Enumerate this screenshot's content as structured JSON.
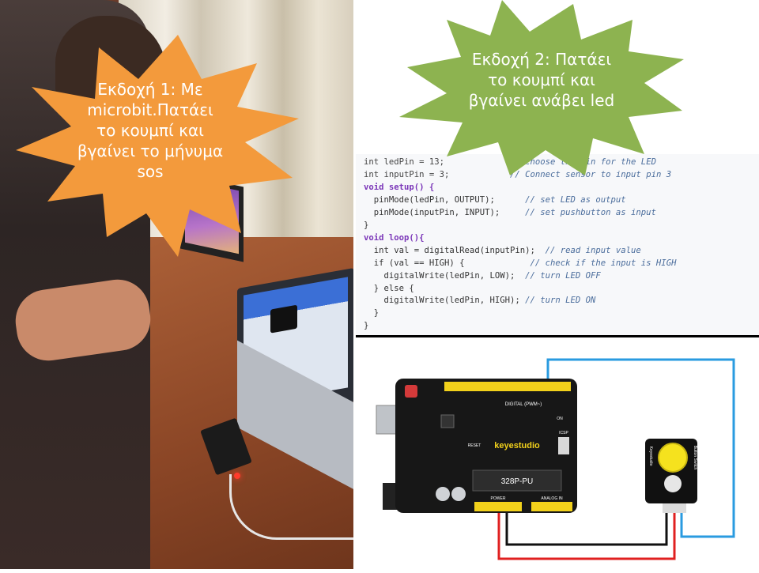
{
  "version1": {
    "title": "Εκδοχή 1: Με",
    "line2": "microbit.Πατάει",
    "line3": "το κουμπί και",
    "line4": "βγαίνει το μήνυμα",
    "line5": "sos",
    "burst_color": "#f39a3c"
  },
  "version2": {
    "title": "Εκδοχή 2: Πατάει",
    "line2": "το κουμπί και",
    "line3": "βγαίνει ανάβει led",
    "burst_color": "#8db350"
  },
  "code": {
    "l1a": "int ledPin = 13;",
    "l1c": "// choose the pin for the LED",
    "l2a": "int inputPin = 3;",
    "l2c": "// Connect sensor to input pin 3",
    "l3": "void setup() {",
    "l4a": "  pinMode(ledPin, OUTPUT);",
    "l4c": "// set LED as output",
    "l5a": "  pinMode(inputPin, INPUT);",
    "l5c": "// set pushbutton as input",
    "l6": "}",
    "l7": "void loop(){",
    "l8a": "  int val = digitalRead(inputPin);",
    "l8c": "// read input value",
    "l9a": "  if (val == HIGH) {",
    "l9c": "// check if the input is HIGH",
    "l10a": "    digitalWrite(ledPin, LOW);",
    "l10c": "// turn LED OFF",
    "l11": "  } else {",
    "l12a": "    digitalWrite(ledPin, HIGH);",
    "l12c": "// turn LED ON",
    "l13": "  }",
    "l14": "}"
  },
  "board": {
    "brand": "keyestudio",
    "chip": "328P-PU",
    "digital_label": "DIGITAL (PWM~)",
    "analog_label": "ANALOG IN",
    "power_label": "POWER",
    "icsp_label": "ICSP",
    "on_label": "ON",
    "reset_label": "RESET",
    "button_module_label": "Button Switch",
    "button_brand": "Keyestudio"
  }
}
